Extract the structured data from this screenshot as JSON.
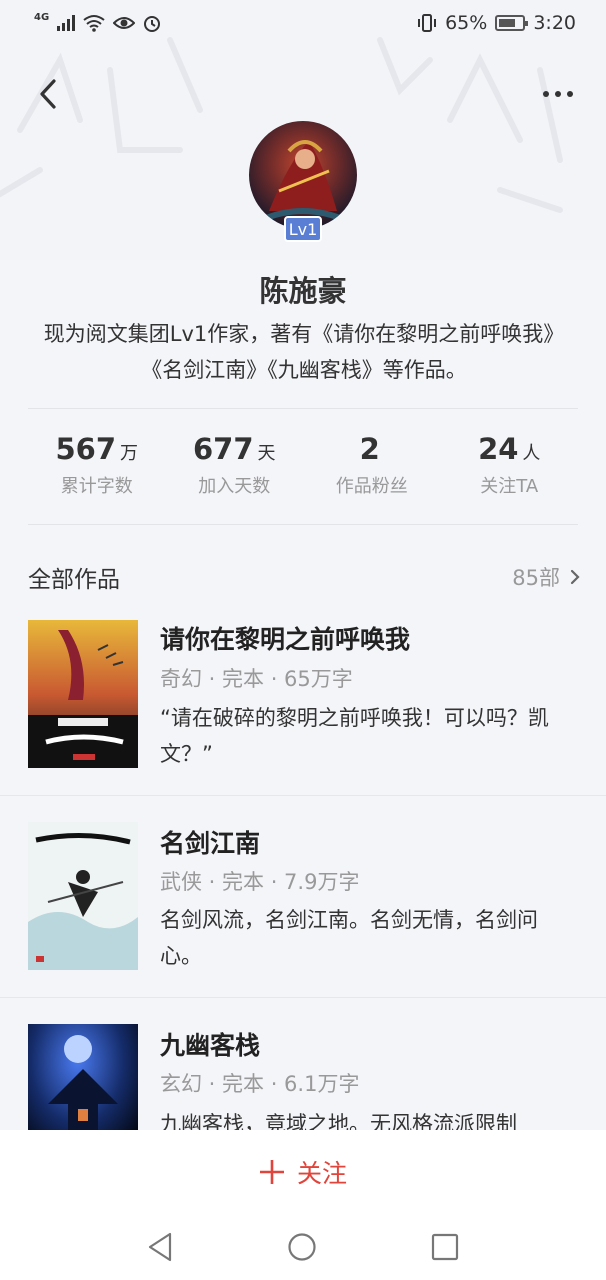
{
  "status_bar": {
    "network": "4G",
    "battery": "65%",
    "time": "3:20"
  },
  "profile": {
    "level": "Lv1",
    "name": "陈施豪",
    "bio": "现为阅文集团Lv1作家，著有《请你在黎明之前呼唤我》《名剑江南》《九幽客栈》等作品。"
  },
  "stats": [
    {
      "value": "567",
      "unit": "万",
      "label": "累计字数"
    },
    {
      "value": "677",
      "unit": "天",
      "label": "加入天数"
    },
    {
      "value": "2",
      "unit": "",
      "label": "作品粉丝"
    },
    {
      "value": "24",
      "unit": "人",
      "label": "关注TA"
    }
  ],
  "works": {
    "title": "全部作品",
    "count": "85部",
    "books": [
      {
        "title": "请你在黎明之前呼唤我",
        "meta": "奇幻 · 完本 · 65万字",
        "desc": "“请在破碎的黎明之前呼唤我！可以吗？凯文？”"
      },
      {
        "title": "名剑江南",
        "meta": "武侠 · 完本 · 7.9万字",
        "desc": "名剑风流，名剑江南。名剑无情，名剑问心。"
      },
      {
        "title": "九幽客栈",
        "meta": "玄幻 · 完本 · 6.1万字",
        "desc": "九幽客栈，竟域之地。无风格流派限制"
      }
    ]
  },
  "follow": {
    "label": "关注"
  },
  "colors": {
    "accent": "#e0443a",
    "badge": "#5a7ed3"
  }
}
